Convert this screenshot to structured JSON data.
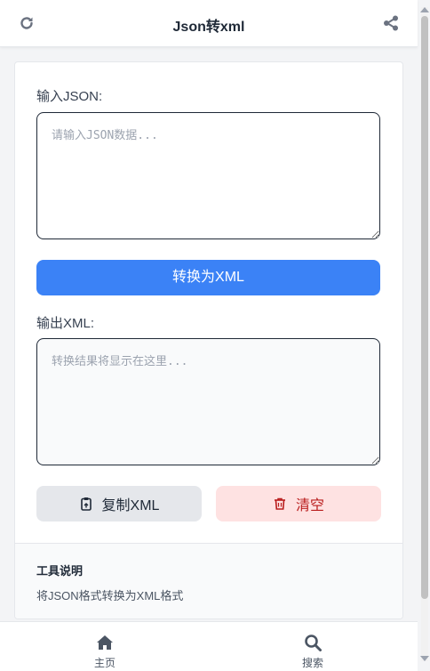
{
  "header": {
    "title": "Json转xml",
    "left_icon": "refresh-icon",
    "right_icon": "share-icon"
  },
  "input": {
    "label": "输入JSON:",
    "placeholder": "请输入JSON数据...",
    "value": ""
  },
  "convert_button": {
    "label": "转换为XML"
  },
  "output": {
    "label": "输出XML:",
    "placeholder": "转换结果将显示在这里...",
    "value": ""
  },
  "actions": {
    "copy": {
      "label": "复制XML",
      "icon": "clipboard-icon"
    },
    "clear": {
      "label": "清空",
      "icon": "trash-icon"
    }
  },
  "tool_info": {
    "title": "工具说明",
    "description": "将JSON格式转换为XML格式"
  },
  "bottom_nav": {
    "items": [
      {
        "label": "主页",
        "icon": "home-icon"
      },
      {
        "label": "搜索",
        "icon": "search-icon"
      }
    ]
  },
  "colors": {
    "primary": "#3b82f6",
    "danger_bg": "#fee2e2",
    "danger_text": "#b91c1c",
    "neutral_bg": "#e5e7eb",
    "icon_gray": "#6b7280",
    "nav_icon": "#4b5563"
  }
}
